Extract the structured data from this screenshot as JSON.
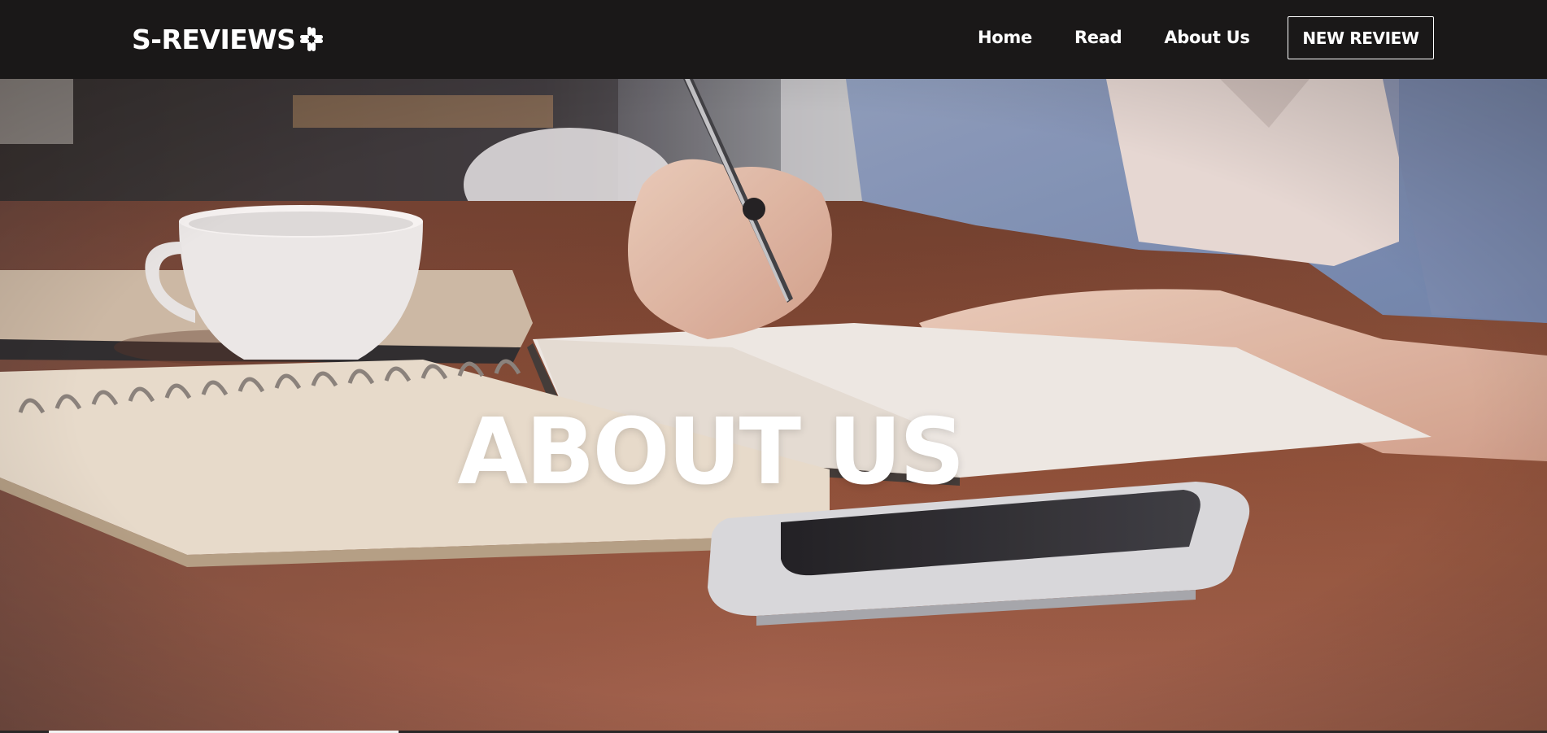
{
  "brand": {
    "name": "S-REVIEWS",
    "icon": "slack-like-hash-icon"
  },
  "nav": {
    "links": [
      "Home",
      "Read",
      "About Us"
    ],
    "cta_label": "NEW REVIEW"
  },
  "hero": {
    "title": "ABOUT US",
    "background": "photo-desk-writing-notebook-coffee-phone"
  },
  "colors": {
    "navbar": "#1a1818",
    "text": "#ffffff",
    "table_wood": "#8a4a33"
  }
}
